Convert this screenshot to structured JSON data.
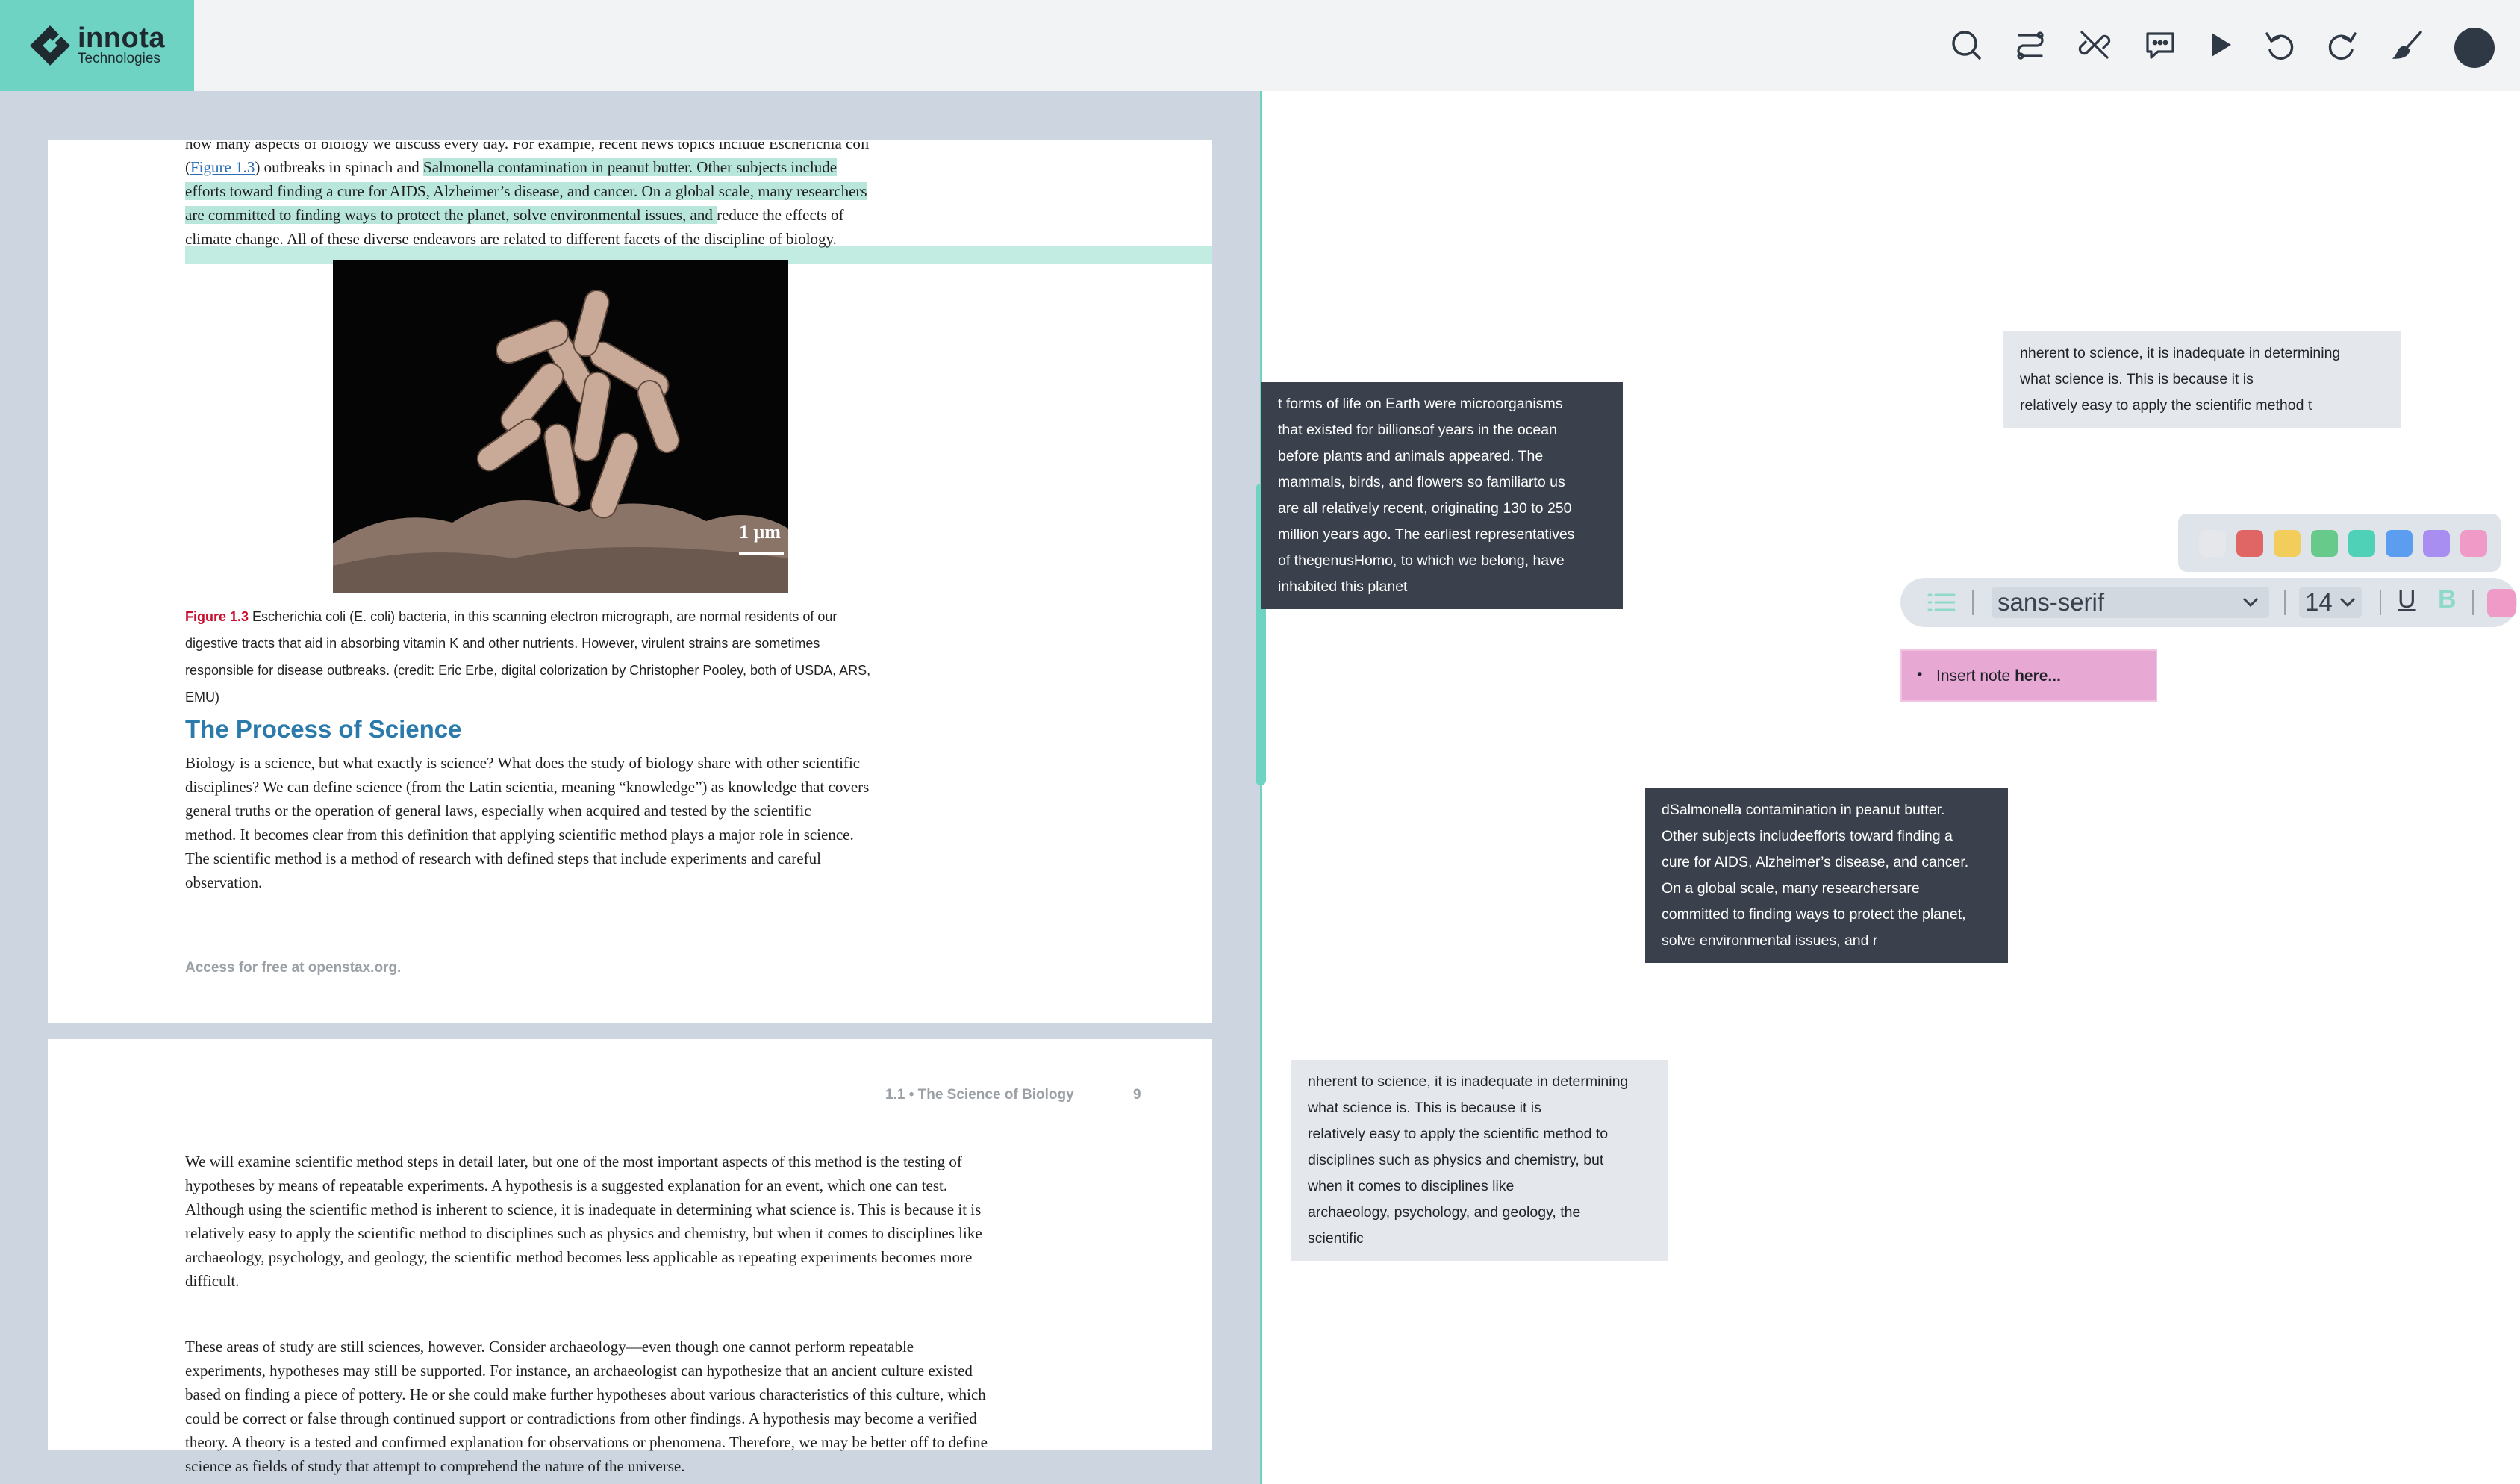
{
  "app": {
    "logo": {
      "name": "innota",
      "subtitle": "Technologies"
    }
  },
  "toolbar": {
    "tools": [
      {
        "icon": "search-icon"
      },
      {
        "icon": "route-icon"
      },
      {
        "icon": "unlink-icon"
      },
      {
        "icon": "comment-icon"
      },
      {
        "icon": "pointer-icon"
      },
      {
        "icon": "undo-icon"
      },
      {
        "icon": "redo-icon"
      },
      {
        "icon": "brush-icon"
      }
    ],
    "avatar": "avatar"
  },
  "document": {
    "page1": {
      "lines": [
        "how many aspects of biology we discuss every day. For example, recent news topics include Escherichia coli",
        "(Figure 1.3) outbreaks in spinach and Salmonella contamination in peanut butter. Other subjects include",
        "efforts toward finding a cure for AIDS, Alzheimer’s disease, and cancer. On a global scale, many researchers",
        "are committed to finding ways to protect the planet, solve environmental issues, and reduce the effects of",
        "climate change. All of these diverse endeavors are related to different facets of the discipline of biology."
      ],
      "figure_link": "Figure 1.3",
      "scale_label": "1 μm",
      "caption_label": "Figure 1.3",
      "caption_lines": [
        "Escherichia coli (E. coli) bacteria, in this scanning electron micrograph, are normal residents of our",
        "digestive tracts that aid in absorbing vitamin K and other nutrients. However, virulent strains are sometimes",
        "responsible for disease outbreaks. (credit: Eric Erbe, digital colorization by Christopher Pooley, both of USDA, ARS,",
        "EMU)"
      ],
      "section_title": "The Process of Science",
      "body_lines": [
        "Biology is a science, but what exactly is science? What does the study of biology share with other scientific",
        "disciplines? We can define science (from the Latin scientia, meaning “knowledge”) as knowledge that covers",
        "general truths or the operation of general laws, especially when acquired and tested by the scientific",
        "method. It becomes clear from this definition that applying scientific method plays a major role in science.",
        "The scientific method is a method of research with defined steps that include experiments and careful",
        "observation."
      ],
      "footer": "Access for free at openstax.org."
    },
    "page2": {
      "running_head": "1.1 • The Science of Biology",
      "page_number": "9",
      "para1": [
        "We will examine scientific method steps in detail later, but one of the most important aspects of this method is the testing of",
        "hypotheses by means of repeatable experiments. A hypothesis is a suggested explanation for an event, which one can test.",
        "Although using the scientific method is inherent to science, it is inadequate in determining what science is. This is because it is",
        "relatively easy to apply the scientific method to disciplines such as physics and chemistry, but when it comes to disciplines like",
        "archaeology, psychology, and geology, the scientific method becomes less applicable as repeating experiments becomes more",
        "difficult."
      ],
      "para2": [
        "These areas of study are still sciences, however. Consider archaeology—even though one cannot perform repeatable",
        "experiments, hypotheses may still be supported. For instance, an archaeologist can hypothesize that an ancient culture existed",
        "based on finding a piece of pottery. He or she could make further hypotheses about various characteristics of this culture, which",
        "could be correct or false through continued support or contradictions from other findings. A hypothesis may become a verified",
        "theory. A theory is a tested and confirmed explanation for observations or phenomena. Therefore, we may be better off to define",
        "science as fields of study that attempt to comprehend the nature of the universe."
      ]
    }
  },
  "notes": [
    {
      "style": "light",
      "lines": [
        "nherent to science, it is inadequate in determining",
        "what science is. This is because it is",
        "relatively easy to apply the scientific method t"
      ]
    },
    {
      "style": "dark",
      "lines": [
        "t forms of life on Earth were microorganisms",
        "that existed for billionsof years in the ocean",
        "before plants and animals appeared. The",
        "mammals, birds, and flowers so familiarto us",
        "are all relatively recent, originating 130 to 250",
        "million years ago. The earliest representatives",
        "of thegenusHomo, to which we belong, have",
        "inhabited this planet"
      ]
    },
    {
      "style": "dark",
      "lines": [
        "dSalmonella contamination in peanut butter.",
        "Other subjects includeefforts toward finding a",
        "cure for AIDS, Alzheimer’s disease, and cancer.",
        "On a global scale, many researchersare",
        "committed to finding ways to protect the planet,",
        "solve environmental issues, and r"
      ]
    },
    {
      "style": "light",
      "lines": [
        "nherent to science, it is inadequate in determining",
        "what science is. This is because it is",
        "relatively easy to apply the scientific method to",
        "disciplines such as physics and chemistry, but",
        "when it comes to disciplines like",
        "archaeology, psychology, and geology, the",
        "scientific"
      ]
    }
  ],
  "palette": {
    "colors": [
      "#e5e7eb",
      "#e06666",
      "#f2cd5c",
      "#67c98a",
      "#4fd1b8",
      "#5b9ef0",
      "#a98ef2",
      "#f09ac8"
    ]
  },
  "format_bar": {
    "font_family": "sans-serif",
    "font_size": "14",
    "underline_label": "U",
    "bold_label": "B",
    "active_color": "#f09ac8"
  },
  "note_editor": {
    "text_before": "Insert note ",
    "text_bold": "here",
    "text_after": "..."
  }
}
